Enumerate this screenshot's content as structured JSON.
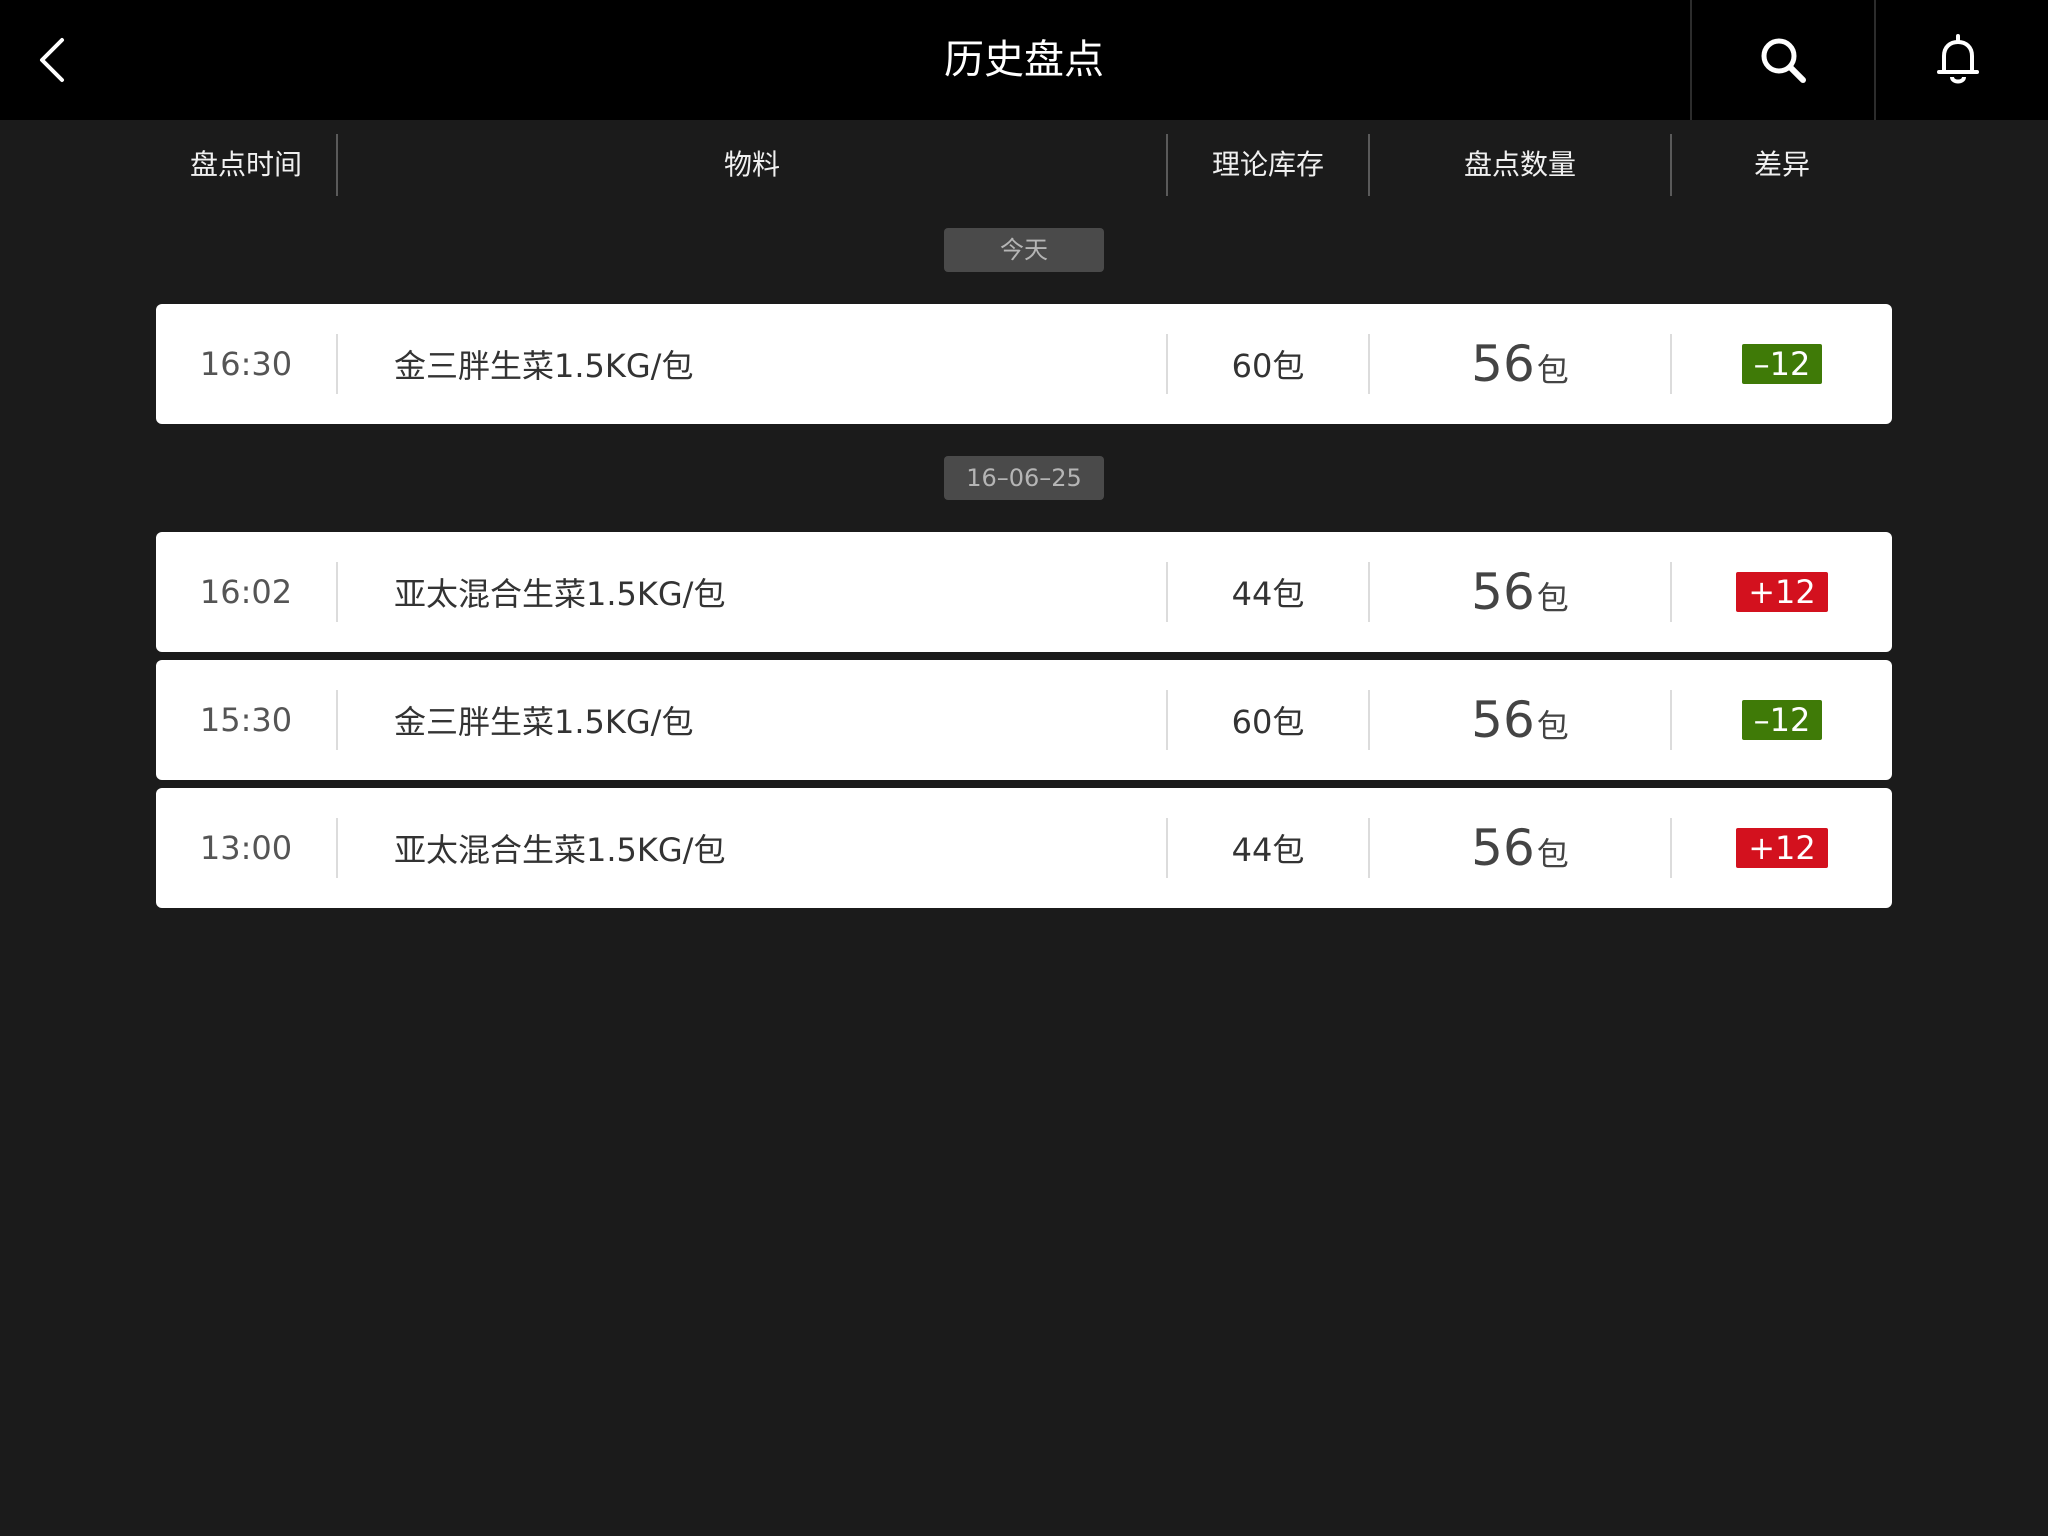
{
  "header": {
    "title": "历史盘点",
    "back_icon": "chevron-left-icon",
    "search_icon": "search-icon",
    "bell_icon": "bell-icon"
  },
  "columns": {
    "time": "盘点时间",
    "material": "物料",
    "theory": "理论库存",
    "count": "盘点数量",
    "diff": "差异"
  },
  "colors": {
    "negative": "#3f7a07",
    "positive": "#d3111e"
  },
  "groups": [
    {
      "date": "今天",
      "rows": [
        {
          "time": "16:30",
          "material": "金三胖生菜1.5KG/包",
          "theory": "60包",
          "count": "56",
          "unit": "包",
          "diff": "–12",
          "diff_sign": "negative"
        }
      ]
    },
    {
      "date": "16–06–25",
      "rows": [
        {
          "time": "16:02",
          "material": "亚太混合生菜1.5KG/包",
          "theory": "44包",
          "count": "56",
          "unit": "包",
          "diff": "+12",
          "diff_sign": "positive"
        },
        {
          "time": "15:30",
          "material": "金三胖生菜1.5KG/包",
          "theory": "60包",
          "count": "56",
          "unit": "包",
          "diff": "–12",
          "diff_sign": "negative"
        },
        {
          "time": "13:00",
          "material": "亚太混合生菜1.5KG/包",
          "theory": "44包",
          "count": "56",
          "unit": "包",
          "diff": "+12",
          "diff_sign": "positive"
        }
      ]
    }
  ]
}
